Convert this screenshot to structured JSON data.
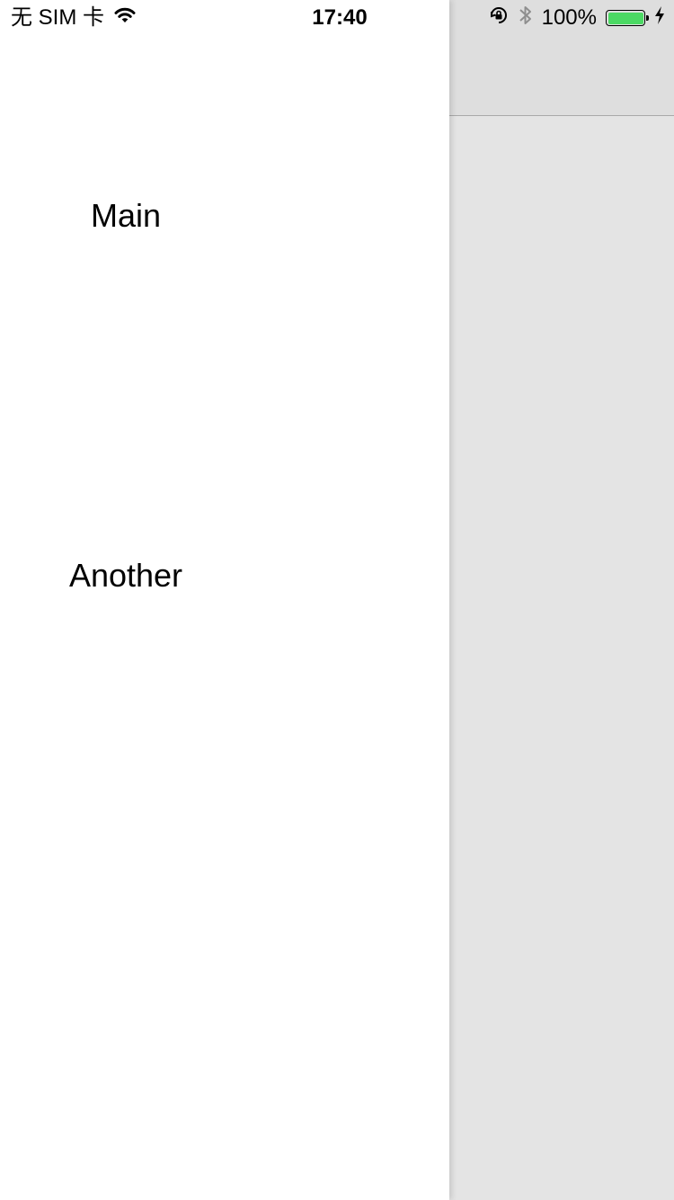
{
  "status_bar": {
    "carrier": "无 SIM 卡",
    "time": "17:40",
    "battery_percent": "100%",
    "battery_level": 1.0,
    "battery_color": "#4cd964",
    "icons": [
      "wifi-icon",
      "rotation-lock-icon",
      "bluetooth-icon",
      "battery-icon",
      "charging-bolt-icon"
    ]
  },
  "drawer": {
    "items": [
      {
        "label": "Main"
      },
      {
        "label": "Another"
      }
    ]
  },
  "colors": {
    "drawer_background": "#ffffff",
    "main_background": "#e4e4e4",
    "navbar_background": "#dedede"
  }
}
